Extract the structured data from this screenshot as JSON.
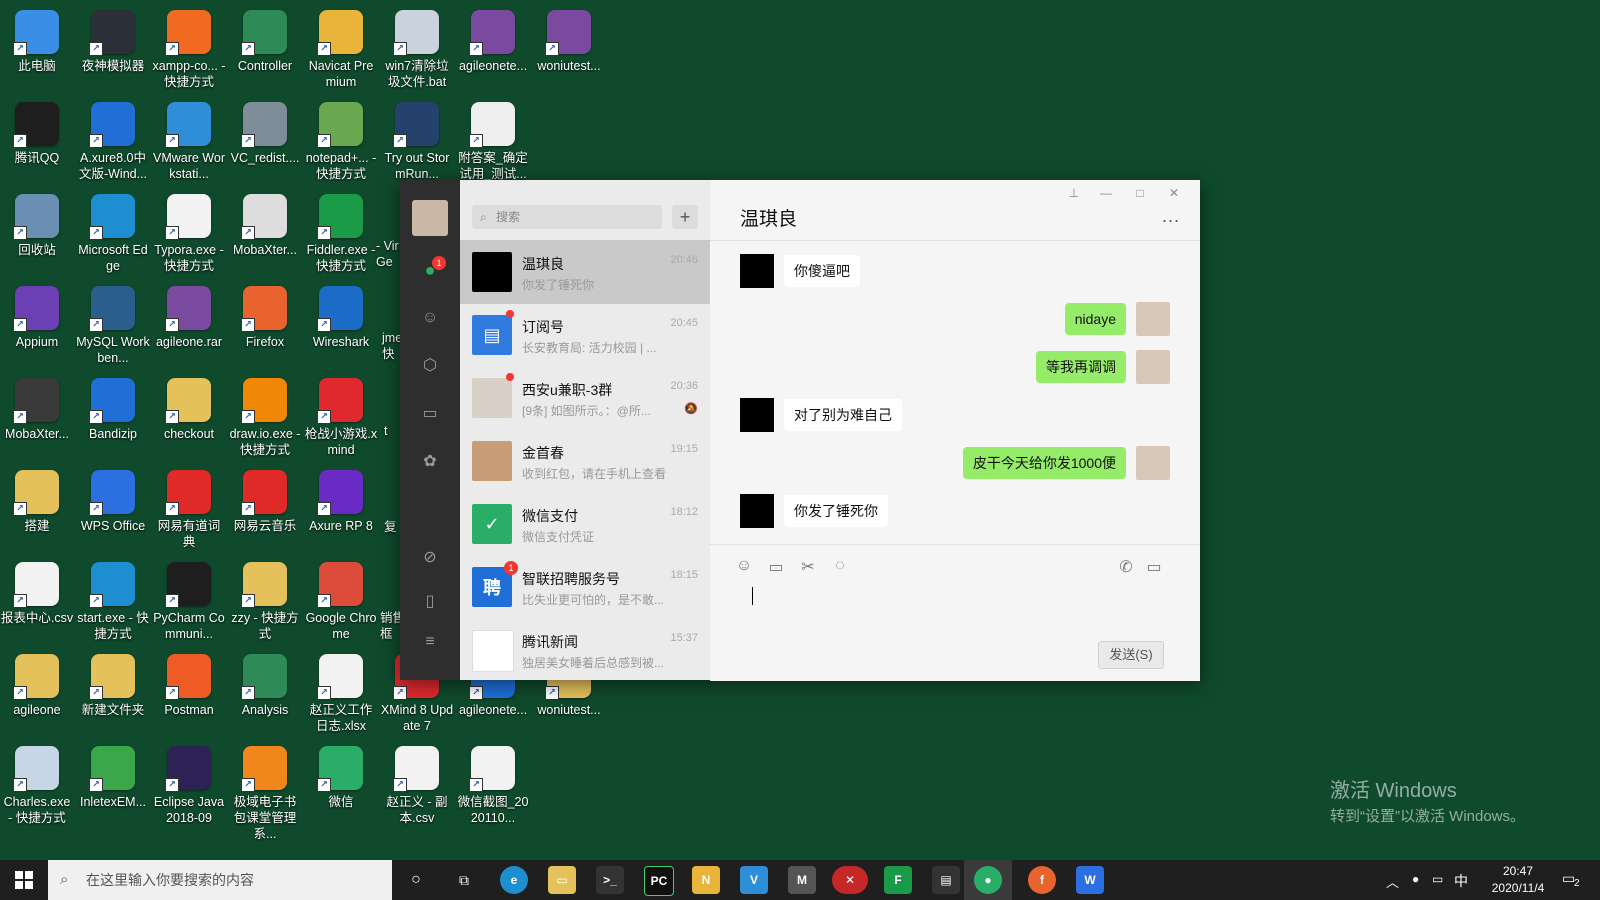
{
  "desktop": {
    "icons": [
      {
        "label": "此电脑",
        "icon": "computer-icon",
        "color": "#3a8ee6"
      },
      {
        "label": "夜神模拟器",
        "icon": "nox-icon",
        "color": "#2b3038"
      },
      {
        "label": "xampp-co... - 快捷方式",
        "icon": "xampp-icon",
        "color": "#f06a22"
      },
      {
        "label": "Controller",
        "icon": "controller-icon",
        "color": "#2e8b57"
      },
      {
        "label": "Navicat Premium",
        "icon": "navicat-icon",
        "color": "#e8b53a"
      },
      {
        "label": "win7清除垃圾文件.bat",
        "icon": "bat-file-icon",
        "color": "#c9d2dd"
      },
      {
        "label": "agileonete...",
        "icon": "rar-icon",
        "color": "#7a4aa0"
      },
      {
        "label": "woniutest...",
        "icon": "rar-icon",
        "color": "#7a4aa0"
      },
      {
        "label": "腾讯QQ",
        "icon": "qq-icon",
        "color": "#1e1e1e"
      },
      {
        "label": "A.xure8.0中文版-Wind...",
        "icon": "zip-icon",
        "color": "#1f6fd6"
      },
      {
        "label": "VMware Workstati...",
        "icon": "vmware-icon",
        "color": "#2f8ed8"
      },
      {
        "label": "VC_redist....",
        "icon": "installer-icon",
        "color": "#7f8c99"
      },
      {
        "label": "notepad+... - 快捷方式",
        "icon": "notepad-plus-icon",
        "color": "#6aa84f"
      },
      {
        "label": "Try out StormRun...",
        "icon": "stormrun-icon",
        "color": "#25426e"
      },
      {
        "label": "附答案_确定试用_测试...",
        "icon": "document-icon",
        "color": "#eeeeee"
      },
      {
        "label": "回收站",
        "icon": "recycle-bin-icon",
        "color": "#6a8fb3"
      },
      {
        "label": "Microsoft Edge",
        "icon": "edge-icon",
        "color": "#1d8fd1"
      },
      {
        "label": "Typora.exe - 快捷方式",
        "icon": "typora-icon",
        "color": "#f2f2f2"
      },
      {
        "label": "MobaXter...",
        "icon": "file-icon",
        "color": "#dddddd"
      },
      {
        "label": "Fiddler.exe - 快捷方式",
        "icon": "fiddler-icon",
        "color": "#1b9a47"
      },
      {
        "label": "Appium",
        "icon": "appium-icon",
        "color": "#6c3fb5"
      },
      {
        "label": "MySQL Workben...",
        "icon": "mysql-icon",
        "color": "#2a5e8c"
      },
      {
        "label": "agileone.rar",
        "icon": "rar-icon",
        "color": "#7a4aa0"
      },
      {
        "label": "Firefox",
        "icon": "firefox-icon",
        "color": "#e8632d"
      },
      {
        "label": "Wireshark",
        "icon": "wireshark-icon",
        "color": "#1b6cc7"
      },
      {
        "label": "MobaXter...",
        "icon": "terminal-icon",
        "color": "#3a3a3a"
      },
      {
        "label": "Bandizip",
        "icon": "bandizip-icon",
        "color": "#1f6fd6"
      },
      {
        "label": "checkout",
        "icon": "folder-icon",
        "color": "#e5c15c"
      },
      {
        "label": "draw.io.exe - 快捷方式",
        "icon": "drawio-icon",
        "color": "#f08705"
      },
      {
        "label": "枪战小游戏.xmind",
        "icon": "xmind-icon",
        "color": "#e0292f"
      },
      {
        "label": "搭建",
        "icon": "folder-icon",
        "color": "#e5c15c"
      },
      {
        "label": "WPS Office",
        "icon": "wps-icon",
        "color": "#2b6fe0"
      },
      {
        "label": "网易有道词典",
        "icon": "youdao-icon",
        "color": "#e02a28"
      },
      {
        "label": "网易云音乐",
        "icon": "netease-music-icon",
        "color": "#e02a28"
      },
      {
        "label": "Axure RP 8",
        "icon": "axure-icon",
        "color": "#6a2bc4"
      },
      {
        "label": "报表中心.csv",
        "icon": "csv-icon",
        "color": "#f2f2f2"
      },
      {
        "label": "start.exe - 快捷方式",
        "icon": "edge-icon",
        "color": "#1d8fd1"
      },
      {
        "label": "PyCharm Communi...",
        "icon": "pycharm-icon",
        "color": "#1e1e1e"
      },
      {
        "label": "zzy - 快捷方式",
        "icon": "folder-icon",
        "color": "#e5c15c"
      },
      {
        "label": "Google Chrome",
        "icon": "chrome-icon",
        "color": "#dd4b39"
      },
      {
        "label": "agileone",
        "icon": "folder-icon",
        "color": "#e5c15c"
      },
      {
        "label": "新建文件夹",
        "icon": "folder-icon",
        "color": "#e5c15c"
      },
      {
        "label": "Postman",
        "icon": "postman-icon",
        "color": "#ef5b25"
      },
      {
        "label": "Analysis",
        "icon": "analysis-icon",
        "color": "#2e8b57"
      },
      {
        "label": "赵正义工作日志.xlsx",
        "icon": "xlsx-icon",
        "color": "#f2f2f2"
      },
      {
        "label": "XMind 8 Update 7",
        "icon": "xmind-icon",
        "color": "#e0292f"
      },
      {
        "label": "agileonete...",
        "icon": "zip-icon",
        "color": "#1f6fd6"
      },
      {
        "label": "woniutest...",
        "icon": "folder-icon",
        "color": "#e5c15c"
      },
      {
        "label": "Charles.exe - 快捷方式",
        "icon": "charles-icon",
        "color": "#c6d6e6"
      },
      {
        "label": "InletexEM...",
        "icon": "inletex-icon",
        "color": "#3aa84a"
      },
      {
        "label": "Eclipse Java 2018-09",
        "icon": "eclipse-icon",
        "color": "#2c2255"
      },
      {
        "label": "极域电子书包课堂管理系...",
        "icon": "classroom-icon",
        "color": "#f0861c"
      },
      {
        "label": "微信",
        "icon": "wechat-icon",
        "color": "#2aae67"
      },
      {
        "label": "赵正义 - 副本.csv",
        "icon": "csv-icon",
        "color": "#f2f2f2"
      },
      {
        "label": "微信截图_2020110...",
        "icon": "image-file-icon",
        "color": "#f2f2f2"
      }
    ],
    "partial_labels": [
      "- Vir Ge",
      "jme 快",
      "t",
      "复",
      "销售 框"
    ]
  },
  "wechat": {
    "search_placeholder": "搜索",
    "add_symbol": "+",
    "nav_badge": "1",
    "conversations": [
      {
        "name": "温琪良",
        "time": "20:46",
        "preview": "你发了锤死你",
        "avatar_color": "#000000",
        "avatar_text": "",
        "selected": true,
        "dot": false,
        "badge": ""
      },
      {
        "name": "订阅号",
        "time": "20:45",
        "preview": "长安教育局: 活力校园 | ...",
        "avatar_color": "#2f7be0",
        "avatar_text": "▤",
        "selected": false,
        "dot": true,
        "badge": ""
      },
      {
        "name": "西安u兼职-3群",
        "time": "20:36",
        "preview": "[9条] 如图所示。：@所...",
        "avatar_color": "#d8cfc6",
        "avatar_text": "",
        "selected": false,
        "dot": true,
        "badge": "",
        "muted": true
      },
      {
        "name": "金首春",
        "time": "19:15",
        "preview": "收到红包，请在手机上查看",
        "avatar_color": "#c79e77",
        "avatar_text": "",
        "selected": false,
        "dot": false,
        "badge": ""
      },
      {
        "name": "微信支付",
        "time": "18:12",
        "preview": "微信支付凭证",
        "avatar_color": "#2aae67",
        "avatar_text": "✓",
        "selected": false,
        "dot": false,
        "badge": ""
      },
      {
        "name": "智联招聘服务号",
        "time": "18:15",
        "preview": "比失业更可怕的，是不敢...",
        "avatar_color": "#1f6fd6",
        "avatar_text": "聘",
        "selected": false,
        "dot": false,
        "badge": "1"
      },
      {
        "name": "腾讯新闻",
        "time": "15:37",
        "preview": "独居美女睡着后总感到被...",
        "avatar_color": "#ffffff",
        "avatar_text": "",
        "selected": false,
        "dot": false,
        "badge": ""
      }
    ],
    "chat": {
      "title": "温琪良",
      "more": "...",
      "messages": [
        {
          "side": "left",
          "text": "你傻逼吧"
        },
        {
          "side": "right",
          "text": "nidaye"
        },
        {
          "side": "right",
          "text": "等我再调调"
        },
        {
          "side": "left",
          "text": "对了别为难自己"
        },
        {
          "side": "right",
          "text": "皮干今天给你发1000便"
        },
        {
          "side": "left",
          "text": "你发了锤死你"
        }
      ],
      "send_label": "发送(S)"
    }
  },
  "activate": {
    "line1": "激活 Windows",
    "line2": "转到“设置”以激活 Windows。"
  },
  "taskbar": {
    "search_placeholder": "在这里输入你要搜索的内容",
    "ime": "中",
    "time": "20:47",
    "date": "2020/11/4",
    "notification_count": "2"
  }
}
